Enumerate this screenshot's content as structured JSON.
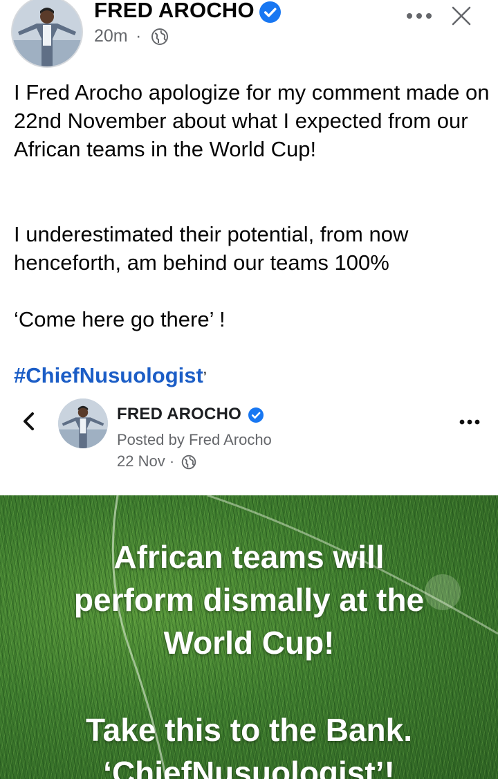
{
  "post": {
    "author_name": "FRED AROCHO",
    "timestamp": "20m",
    "separator": "·",
    "privacy_icon": "globe-icon",
    "more_icon": "more-horizontal-icon",
    "close_icon": "close-icon",
    "paragraphs": [
      "I Fred Arocho apologize for my comment made on 22nd November about what I expected from our African teams in the World Cup!",
      "I underestimated their potential, from now henceforth, am behind our teams 100%",
      "‘Come here go there’ !"
    ],
    "hashtag": "#ChiefNusuologist",
    "hashtag_tail": "’"
  },
  "shared": {
    "back_icon": "chevron-left-icon",
    "author_name": "FRED AROCHO",
    "posted_by": "Posted by Fred Arocho",
    "date": "22 Nov ·",
    "privacy_icon": "globe-icon",
    "more_icon": "more-horizontal-icon",
    "image_text": {
      "line_1": "African teams will\nperform dismally at the\nWorld Cup!",
      "line_2": "Take this to the Bank.\n‘ChiefNusuologist’!"
    }
  },
  "colors": {
    "verified_badge": "#1877f2",
    "hashtag": "#1b5dc6",
    "secondary_text": "#65676b",
    "grass": "#3d7a2e"
  }
}
